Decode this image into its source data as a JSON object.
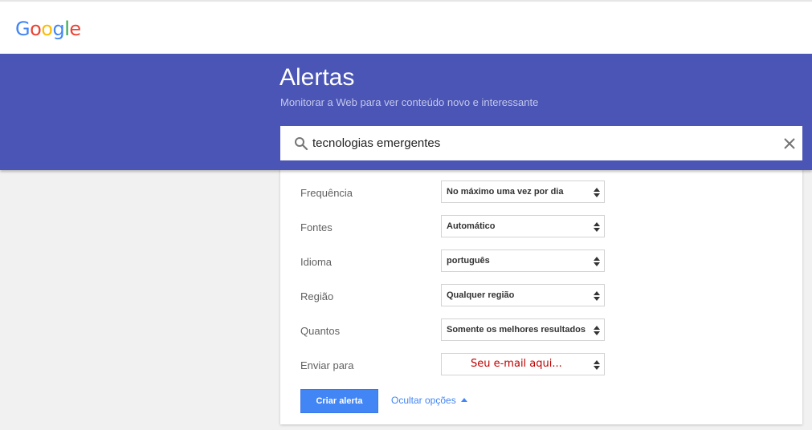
{
  "brand": {
    "logo_letters": [
      "G",
      "o",
      "o",
      "g",
      "l",
      "e"
    ],
    "logo_colors": [
      "#4285f4",
      "#ea4335",
      "#fbbc05",
      "#4285f4",
      "#34a853",
      "#ea4335"
    ]
  },
  "header": {
    "title": "Alertas",
    "subtitle": "Monitorar a Web para ver conteúdo novo e interessante",
    "accent_color": "#4a55b5"
  },
  "search": {
    "value": "tecnologias emergentes",
    "icon": "search-icon",
    "clear_icon": "close-icon"
  },
  "options": [
    {
      "label": "Frequência",
      "value": "No máximo uma vez por dia"
    },
    {
      "label": "Fontes",
      "value": "Automático"
    },
    {
      "label": "Idioma",
      "value": "português"
    },
    {
      "label": "Região",
      "value": "Qualquer região"
    },
    {
      "label": "Quantos",
      "value": "Somente os melhores resultados"
    },
    {
      "label": "Enviar para",
      "value": "Seu e-mail aqui..."
    }
  ],
  "actions": {
    "create_label": "Criar alerta",
    "create_color": "#4285f4",
    "hide_options_label": "Ocultar opções"
  }
}
